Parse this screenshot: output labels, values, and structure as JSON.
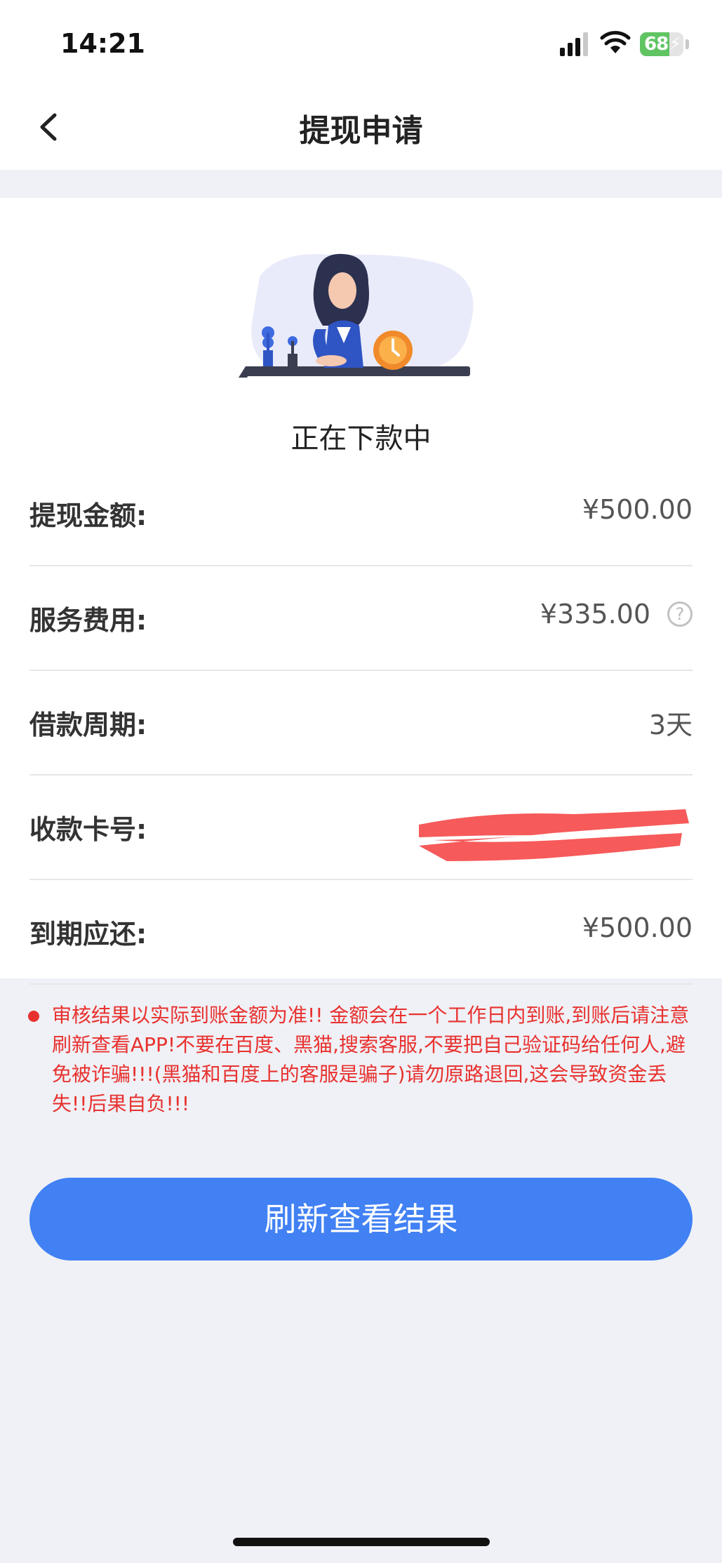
{
  "status_bar": {
    "time": "14:21",
    "battery": "68",
    "battery_level": 0.68
  },
  "nav": {
    "title": "提现申请"
  },
  "status": {
    "text": "正在下款中"
  },
  "rows": [
    {
      "label": "提现金额:",
      "value": "¥500.00"
    },
    {
      "label": "服务费用:",
      "value": "¥335.00"
    },
    {
      "label": "借款周期:",
      "value": "3天"
    },
    {
      "label": "收款卡号:",
      "value": ""
    },
    {
      "label": "到期应还:",
      "value": "¥500.00"
    }
  ],
  "help_icon": "question-mark-icon",
  "notice": {
    "text": "审核结果以实际到账金额为准!! 金额会在一个工作日内到账,到账后请注意刷新查看APP!不要在百度、黑猫,搜索客服,不要把自己验证码给任何人,避免被诈骗!!!(黑猫和百度上的客服是骗子)请勿原路退回,这会导致资金丢失!!后果自负!!!"
  },
  "button": {
    "label": "刷新查看结果"
  },
  "colors": {
    "accent": "#4181f4",
    "warning": "#e8312f",
    "background": "#eff1f6"
  }
}
